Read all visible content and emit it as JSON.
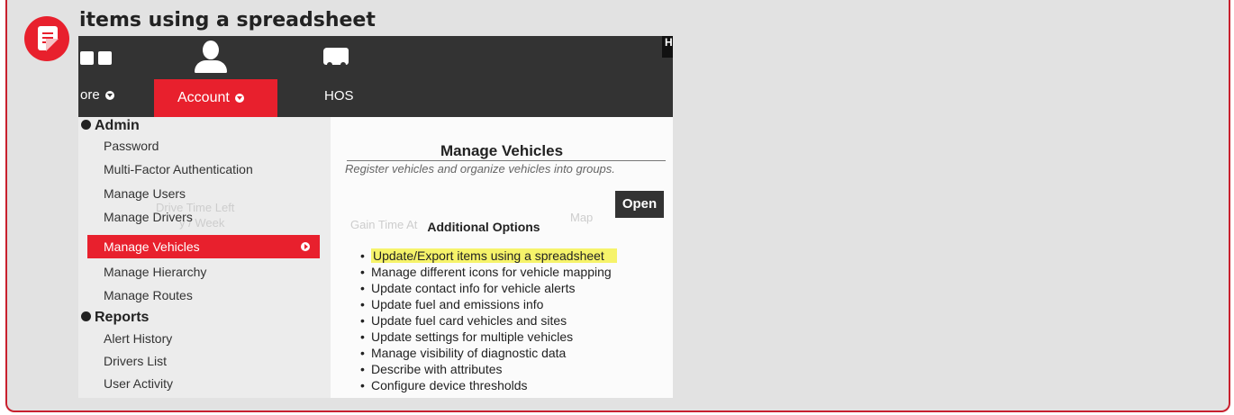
{
  "heading": "items using a spreadsheet",
  "colors": {
    "accent": "#e8202d",
    "topbar": "#333333",
    "highlight": "#f6f36a"
  },
  "screenshot": {
    "nav": {
      "more_label": "ore",
      "account_label": "Account",
      "hos_label": "HOS",
      "corner_label": "H"
    },
    "admin": {
      "title": "Admin",
      "items": [
        "Password",
        "Multi-Factor Authentication",
        "Manage Users",
        "Manage Drivers",
        "Manage Vehicles",
        "Manage Hierarchy",
        "Manage Routes"
      ]
    },
    "reports": {
      "title": "Reports",
      "items": [
        "Alert History",
        "Drivers List",
        "User Activity"
      ]
    },
    "manage_vehicles": {
      "title": "Manage Vehicles",
      "subtitle": "Register vehicles and organize vehicles into groups.",
      "open_label": "Open",
      "additional_title": "Additional Options",
      "options": [
        "Update/Export items using a spreadsheet",
        "Manage different icons for vehicle mapping",
        "Update contact info for vehicle alerts",
        "Update fuel and emissions info",
        "Update fuel card vehicles and sites",
        "Update settings for multiple vehicles",
        "Manage visibility of diagnostic data",
        "Describe with attributes",
        "Configure device thresholds"
      ]
    },
    "background_ghost": {
      "drive_time_left": "Drive Time Left",
      "day_week": "y / Week",
      "gain_time": "Gain Time At",
      "map": "Map"
    }
  }
}
